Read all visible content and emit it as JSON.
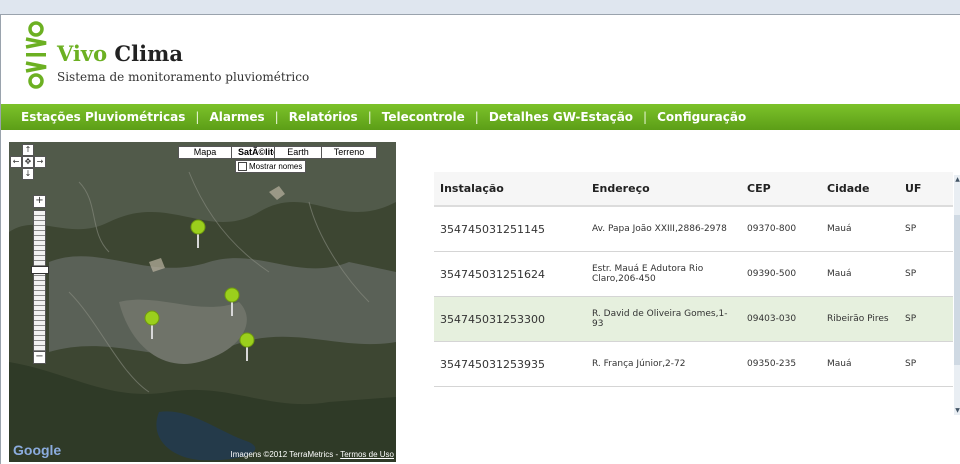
{
  "brand": {
    "logo_text": "vivo",
    "title_accent": "Vivo",
    "title_rest": " Clima",
    "subtitle": "Sistema de monitoramento pluviométrico"
  },
  "nav": {
    "items": [
      {
        "label": "Estações Pluviométricas"
      },
      {
        "label": "Alarmes"
      },
      {
        "label": "Relatórios"
      },
      {
        "label": "Telecontrole"
      },
      {
        "label": "Detalhes GW-Estação"
      },
      {
        "label": "Configuração"
      }
    ],
    "separator": "|"
  },
  "map": {
    "map_types": [
      "Mapa",
      "SatÃ©lite",
      "Earth",
      "Terreno"
    ],
    "selected_map_type": "SatÃ©lite",
    "show_names_label": "Mostrar nomes",
    "show_names_checked": false,
    "google_logo": "Google",
    "attribution": "Imagens ©2012 TerraMetrics - ",
    "terms_link": "Termos de Uso",
    "marker_color": "#9bcf1c"
  },
  "table": {
    "headers": [
      "Instalação",
      "Endereço",
      "CEP",
      "Cidade",
      "UF"
    ],
    "rows": [
      {
        "instalacao": "354745031251145",
        "endereco": "Av. Papa João XXIII,2886-2978",
        "cep": "09370-800",
        "cidade": "Mauá",
        "uf": "SP",
        "highlighted": false
      },
      {
        "instalacao": "354745031251624",
        "endereco": "Estr. Mauá E Adutora Rio Claro,206-450",
        "cep": "09390-500",
        "cidade": "Mauá",
        "uf": "SP",
        "highlighted": false
      },
      {
        "instalacao": "354745031253300",
        "endereco": "R. David de Oliveira Gomes,1-93",
        "cep": "09403-030",
        "cidade": "Ribeirão Pires",
        "uf": "SP",
        "highlighted": true
      },
      {
        "instalacao": "354745031253935",
        "endereco": "R. França Júnior,2-72",
        "cep": "09350-235",
        "cidade": "Mauá",
        "uf": "SP",
        "highlighted": false
      }
    ]
  },
  "colors": {
    "brand_green": "#6cb022",
    "nav_green": "#6cb022",
    "row_highlight": "#e6f0de"
  }
}
